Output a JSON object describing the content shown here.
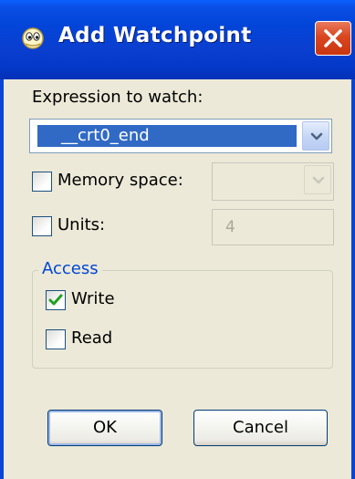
{
  "window": {
    "title": "Add Watchpoint",
    "app_icon": "watchpoint-icon",
    "close_icon": "close-icon"
  },
  "expression": {
    "label": "Expression to watch:",
    "value": "__crt0_end"
  },
  "memory_space": {
    "label": "Memory space:",
    "checked": false,
    "value": ""
  },
  "units": {
    "label": "Units:",
    "checked": false,
    "value": "4"
  },
  "access": {
    "legend": "Access",
    "write_label": "Write",
    "write_checked": true,
    "read_label": "Read",
    "read_checked": false
  },
  "buttons": {
    "ok_label": "OK",
    "cancel_label": "Cancel"
  },
  "colors": {
    "titlebar": "#0245d9",
    "selection": "#316ac5",
    "group_legend": "#0046d5",
    "checkmark": "#21a121",
    "close_button": "#d9461f"
  }
}
